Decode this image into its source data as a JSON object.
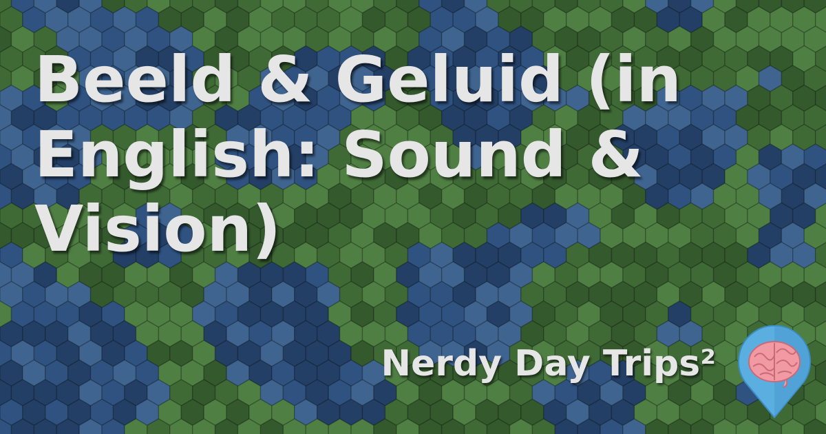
{
  "title": "Beeld & Geluid (in English: Sound & Vision)",
  "site_name": "Nerdy Day Trips²",
  "logo_icon": "brain-map-pin-icon",
  "colors": {
    "green_light": "#4f7f43",
    "green_mid": "#3f6a36",
    "green_dark": "#34592d",
    "blue_light": "#3f6490",
    "blue_mid": "#2f5280",
    "blue_dark": "#233f66",
    "text": "#e6e6e6",
    "pin": "#5aaee0",
    "brain": "#f29aa4"
  }
}
